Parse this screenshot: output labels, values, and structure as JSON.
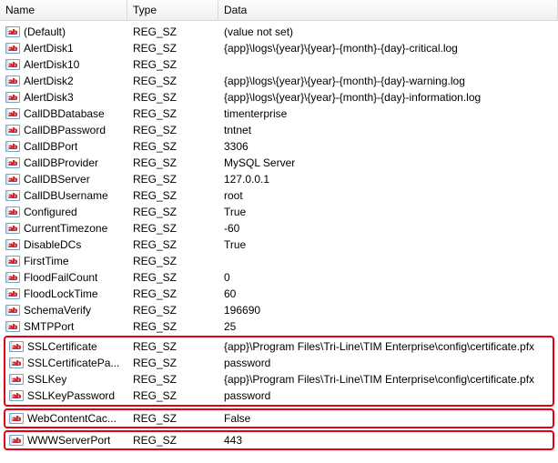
{
  "columns": {
    "name": "Name",
    "type": "Type",
    "data": "Data"
  },
  "rows": [
    {
      "name": "(Default)",
      "type": "REG_SZ",
      "data": "(value not set)"
    },
    {
      "name": "AlertDisk1",
      "type": "REG_SZ",
      "data": "{app}\\logs\\{year}\\{year}-{month}-{day}-critical.log"
    },
    {
      "name": "AlertDisk10",
      "type": "REG_SZ",
      "data": ""
    },
    {
      "name": "AlertDisk2",
      "type": "REG_SZ",
      "data": "{app}\\logs\\{year}\\{year}-{month}-{day}-warning.log"
    },
    {
      "name": "AlertDisk3",
      "type": "REG_SZ",
      "data": "{app}\\logs\\{year}\\{year}-{month}-{day}-information.log"
    },
    {
      "name": "CallDBDatabase",
      "type": "REG_SZ",
      "data": "timenterprise"
    },
    {
      "name": "CallDBPassword",
      "type": "REG_SZ",
      "data": "tntnet"
    },
    {
      "name": "CallDBPort",
      "type": "REG_SZ",
      "data": "3306"
    },
    {
      "name": "CallDBProvider",
      "type": "REG_SZ",
      "data": "MySQL Server"
    },
    {
      "name": "CallDBServer",
      "type": "REG_SZ",
      "data": "127.0.0.1"
    },
    {
      "name": "CallDBUsername",
      "type": "REG_SZ",
      "data": "root"
    },
    {
      "name": "Configured",
      "type": "REG_SZ",
      "data": "True"
    },
    {
      "name": "CurrentTimezone",
      "type": "REG_SZ",
      "data": "-60"
    },
    {
      "name": "DisableDCs",
      "type": "REG_SZ",
      "data": "True"
    },
    {
      "name": "FirstTime",
      "type": "REG_SZ",
      "data": ""
    },
    {
      "name": "FloodFailCount",
      "type": "REG_SZ",
      "data": "0"
    },
    {
      "name": "FloodLockTime",
      "type": "REG_SZ",
      "data": "60"
    },
    {
      "name": "SchemaVerify",
      "type": "REG_SZ",
      "data": "196690"
    },
    {
      "name": "SMTPPort",
      "type": "REG_SZ",
      "data": "25"
    },
    {
      "name": "SSLCertificate",
      "type": "REG_SZ",
      "data": "{app}\\Program Files\\Tri-Line\\TIM Enterprise\\config\\certificate.pfx",
      "highlight": "ssl"
    },
    {
      "name": "SSLCertificatePa...",
      "type": "REG_SZ",
      "data": "password",
      "highlight": "ssl"
    },
    {
      "name": "SSLKey",
      "type": "REG_SZ",
      "data": "{app}\\Program Files\\Tri-Line\\TIM Enterprise\\config\\certificate.pfx",
      "highlight": "ssl"
    },
    {
      "name": "SSLKeyPassword",
      "type": "REG_SZ",
      "data": "password",
      "highlight": "ssl"
    },
    {
      "name": "WebContentCac...",
      "type": "REG_SZ",
      "data": "False",
      "highlight": "web"
    },
    {
      "name": "WWWServerPort",
      "type": "REG_SZ",
      "data": "443",
      "highlight": "www"
    }
  ]
}
